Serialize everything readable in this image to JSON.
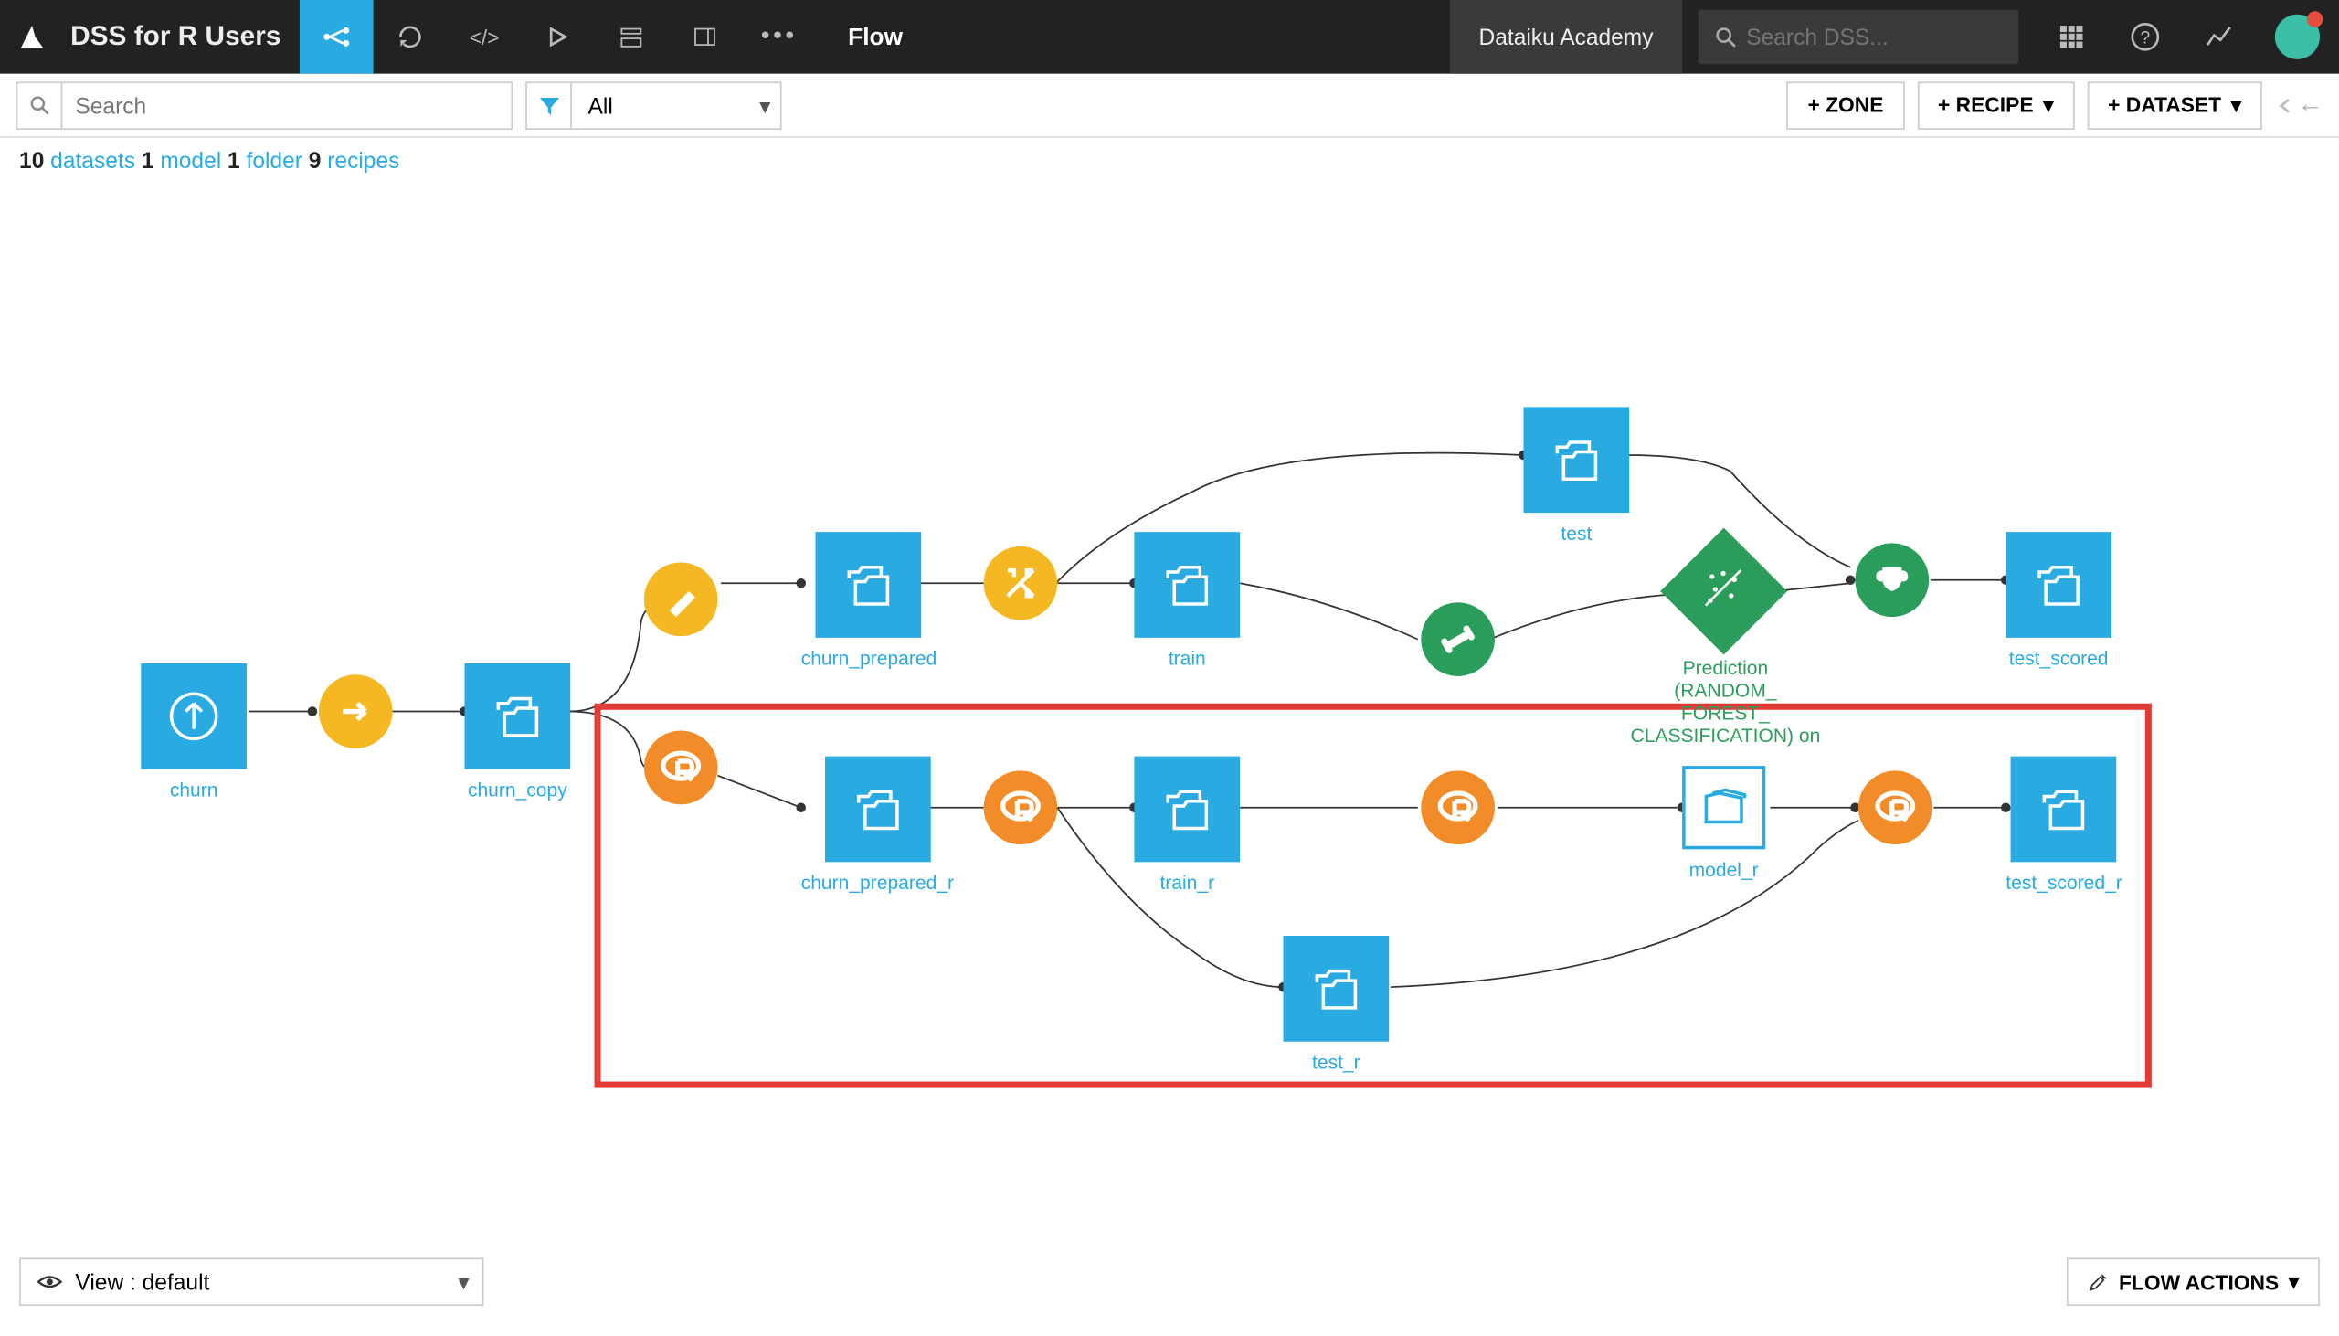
{
  "topbar": {
    "project_title": "DSS for R Users",
    "page_title": "Flow",
    "academy_label": "Dataiku Academy",
    "search_placeholder": "Search DSS..."
  },
  "subbar": {
    "search_placeholder": "Search",
    "filter_value": "All",
    "btn_zone": "+ ZONE",
    "btn_recipe": "+ RECIPE",
    "btn_dataset": "+ DATASET"
  },
  "countbar": {
    "datasets_n": "10",
    "datasets_lbl": "datasets",
    "model_n": "1",
    "model_lbl": "model",
    "folder_n": "1",
    "folder_lbl": "folder",
    "recipes_n": "9",
    "recipes_lbl": "recipes"
  },
  "nodes": {
    "churn": "churn",
    "churn_copy": "churn_copy",
    "churn_prepared": "churn_prepared",
    "train": "train",
    "test": "test",
    "prediction": "Prediction (RANDOM_\nFOREST_\nCLASSIFICATION) on",
    "test_scored": "test_scored",
    "churn_prepared_r": "churn_prepared_r",
    "train_r": "train_r",
    "test_r": "test_r",
    "model_r": "model_r",
    "test_scored_r": "test_scored_r"
  },
  "bottombar": {
    "view_label": "View : default",
    "flow_actions": "FLOW ACTIONS"
  }
}
